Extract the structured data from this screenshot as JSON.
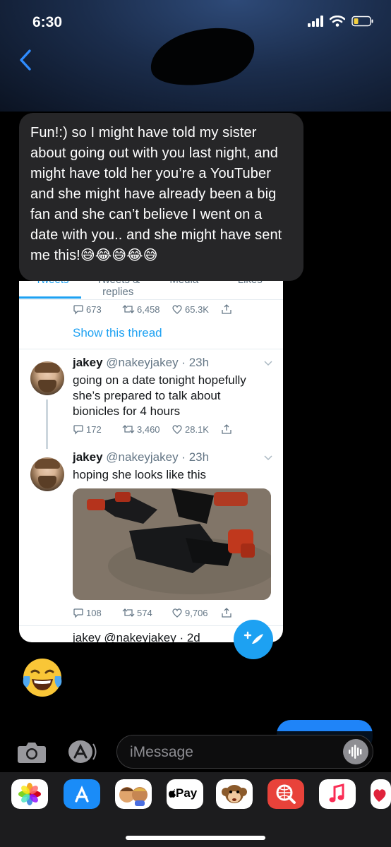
{
  "status_bar": {
    "time": "6:30"
  },
  "conversation": {
    "incoming_text": "Fun!:) so I might have told my sister about going out with you last night, and might have told her you’re a YouTuber and she might have already been a big fan and she can’t believe I went on a date with you.. and she might have sent me this!😅😂😅😂😅"
  },
  "twitter_screenshot": {
    "tabs": [
      "Tweets",
      "Tweets & replies",
      "Media",
      "Likes"
    ],
    "top_tweet_actions": {
      "replies": "673",
      "retweets": "6,458",
      "likes": "65.3K"
    },
    "show_thread": "Show this thread",
    "tweets": [
      {
        "name": "jakey",
        "handle": "@nakeyjakey · 23h",
        "text": "going on a date tonight hopefully she’s prepared to talk about bionicles for 4 hours",
        "replies": "172",
        "retweets": "3,460",
        "likes": "28.1K"
      },
      {
        "name": "jakey",
        "handle": "@nakeyjakey · 23h",
        "text": "hoping she looks like this",
        "replies": "108",
        "retweets": "574",
        "likes": "9,706"
      }
    ],
    "next_tweet_partial": "jakey @nakeyjakey · 2d",
    "fab_icon": "compose-plus"
  },
  "composer": {
    "placeholder": "iMessage"
  },
  "app_drawer": {
    "apps": [
      "photos",
      "app-store",
      "memoji",
      "Pay",
      "monkey-animoji",
      "web-search",
      "music",
      "heart"
    ],
    "apple_pay_label": "Pay"
  },
  "colors": {
    "incoming_bubble": "#262628",
    "sent_bubble": "#1f84f8",
    "twitter_blue": "#1da1f2",
    "ios_blue": "#2f8cff"
  }
}
